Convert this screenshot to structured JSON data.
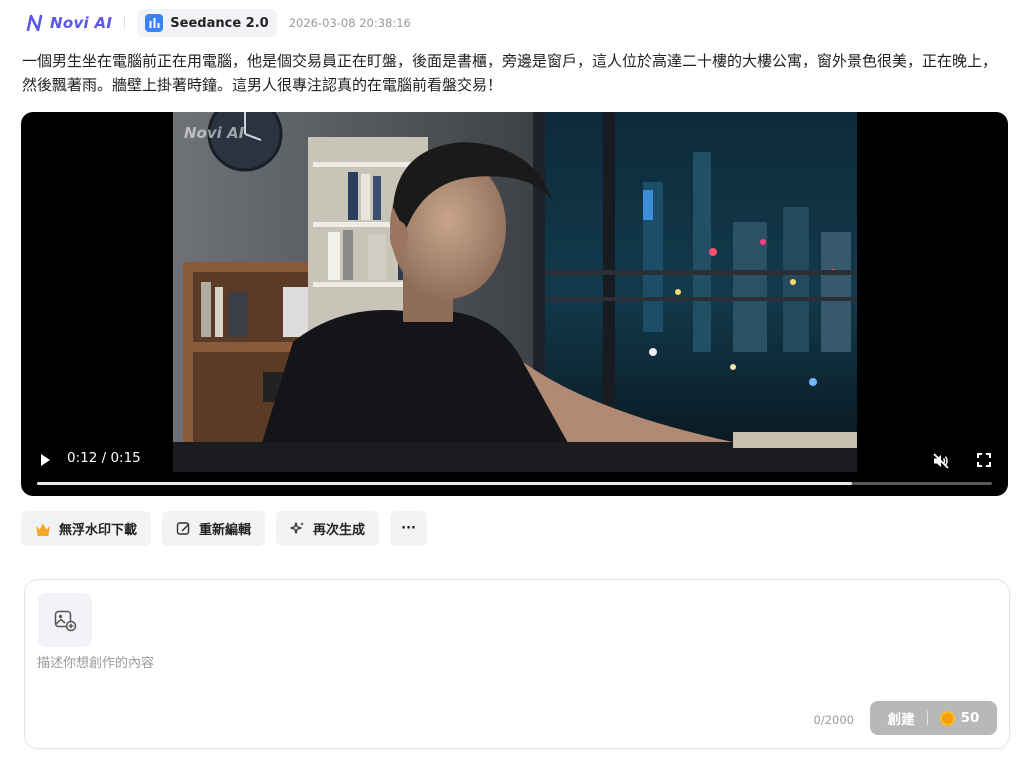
{
  "header": {
    "brand": "Novi AI",
    "model": "Seedance 2.0",
    "timestamp": "2026-03-08 20:38:16"
  },
  "prompt_text": "一個男生坐在電腦前正在用電腦，他是個交易員正在盯盤，後面是書櫃，旁邊是窗戶，這人位於高達二十樓的大樓公寓，窗外景色很美，正在晚上，然後飄著雨。牆壁上掛著時鐘。這男人很專注認真的在電腦前看盤交易！",
  "video": {
    "watermark": "Novi AI",
    "current_time": "0:12",
    "duration": "0:15",
    "time_display": "0:12 / 0:15",
    "progress": 0.853,
    "muted": true
  },
  "actions": {
    "download_label": "無浮水印下載",
    "reedit_label": "重新編輯",
    "regenerate_label": "再次生成",
    "more_label": "···"
  },
  "composer": {
    "placeholder": "描述你想創作的內容",
    "value": "",
    "counter": "0/2000",
    "create_label": "創建",
    "cost": "50"
  },
  "colors": {
    "brand": "#5b57e8",
    "model_icon": "#3b82f6",
    "create_button": "#b8b8b8",
    "coin": "#f59e0b",
    "crown": "#f5a623"
  }
}
